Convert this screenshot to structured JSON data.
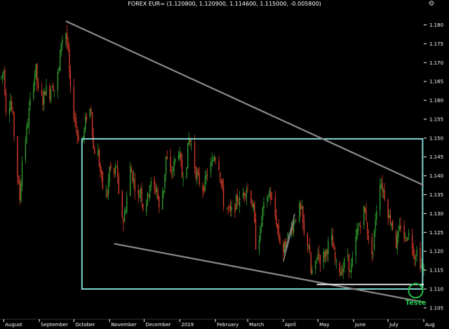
{
  "app": {
    "settings_icon": "gear-icon",
    "settings_glyph": "⚙"
  },
  "chart_data": {
    "type": "candlestick",
    "title": "FOREX EUR= (1.120800, 1.120900, 1.114600, 1.115000, -0.005800)",
    "y_ticks": [
      "1.180",
      "1.175",
      "1.170",
      "1.165",
      "1.160",
      "1.155",
      "1.150",
      "1.145",
      "1.140",
      "1.135",
      "1.130",
      "1.125",
      "1.120",
      "1.115",
      "1.110",
      "1.105"
    ],
    "ylim": [
      1.102,
      1.184
    ],
    "x_ticks": [
      "August",
      "September",
      "October",
      "November",
      "December",
      "2019",
      "February",
      "March",
      "April",
      "May",
      "June",
      "July",
      "Aug"
    ],
    "xlim": [
      "2018-07-30",
      "2019-08-01"
    ],
    "annotation_label": "Teste",
    "colors": {
      "background": "#000000",
      "up": "#2e9b2e",
      "down": "#d43a2a",
      "trendline": "#8a8a8a",
      "box": "#7fd6cf",
      "support": "#ffffff",
      "annotation": "#22c24a"
    },
    "trendlines": [
      {
        "from": [
          "2018-09-24",
          1.181
        ],
        "to": [
          "2019-08-01",
          1.1375
        ]
      },
      {
        "from": [
          "2018-11-05",
          1.122
        ],
        "to": [
          "2019-08-01",
          1.1065
        ]
      },
      {
        "from": [
          "2019-04-02",
          1.1195
        ],
        "to": [
          "2019-04-11",
          1.13
        ]
      },
      {
        "from": [
          "2019-04-01",
          1.1172
        ],
        "to": [
          "2019-04-10",
          1.1277
        ]
      }
    ],
    "rectangle": {
      "x": [
        "2018-10-08",
        "2019-07-31"
      ],
      "y": [
        1.11,
        1.1498
      ]
    },
    "support": {
      "x": [
        "2019-04-30",
        "2019-08-01"
      ],
      "y": 1.1112
    },
    "highlight": {
      "x": "2019-07-25",
      "y": 1.1088
    },
    "price_path": [
      [
        "2018-07-30",
        1.166
      ],
      [
        "2018-08-01",
        1.168
      ],
      [
        "2018-08-03",
        1.158
      ],
      [
        "2018-08-07",
        1.16
      ],
      [
        "2018-08-09",
        1.155
      ],
      [
        "2018-08-13",
        1.14
      ],
      [
        "2018-08-15",
        1.134
      ],
      [
        "2018-08-17",
        1.144
      ],
      [
        "2018-08-21",
        1.152
      ],
      [
        "2018-08-23",
        1.157
      ],
      [
        "2018-08-27",
        1.166
      ],
      [
        "2018-08-29",
        1.168
      ],
      [
        "2018-08-31",
        1.162
      ],
      [
        "2018-09-04",
        1.16
      ],
      [
        "2018-09-06",
        1.163
      ],
      [
        "2018-09-10",
        1.162
      ],
      [
        "2018-09-12",
        1.165
      ],
      [
        "2018-09-14",
        1.163
      ],
      [
        "2018-09-18",
        1.168
      ],
      [
        "2018-09-20",
        1.176
      ],
      [
        "2018-09-24",
        1.178
      ],
      [
        "2018-09-26",
        1.172
      ],
      [
        "2018-09-28",
        1.162
      ],
      [
        "2018-10-02",
        1.155
      ],
      [
        "2018-10-04",
        1.151
      ],
      [
        "2018-10-08",
        1.149
      ],
      [
        "2018-10-10",
        1.152
      ],
      [
        "2018-10-12",
        1.156
      ],
      [
        "2018-10-16",
        1.158
      ],
      [
        "2018-10-18",
        1.147
      ],
      [
        "2018-10-22",
        1.146
      ],
      [
        "2018-10-24",
        1.141
      ],
      [
        "2018-10-26",
        1.137
      ],
      [
        "2018-10-30",
        1.135
      ],
      [
        "2018-11-01",
        1.142
      ],
      [
        "2018-11-05",
        1.14
      ],
      [
        "2018-11-07",
        1.143
      ],
      [
        "2018-11-09",
        1.134
      ],
      [
        "2018-11-13",
        1.128
      ],
      [
        "2018-11-15",
        1.132
      ],
      [
        "2018-11-19",
        1.142
      ],
      [
        "2018-11-21",
        1.14
      ],
      [
        "2018-11-26",
        1.134
      ],
      [
        "2018-11-28",
        1.137
      ],
      [
        "2018-11-30",
        1.132
      ],
      [
        "2018-12-04",
        1.134
      ],
      [
        "2018-12-06",
        1.138
      ],
      [
        "2018-12-10",
        1.136
      ],
      [
        "2018-12-12",
        1.137
      ],
      [
        "2018-12-14",
        1.131
      ],
      [
        "2018-12-18",
        1.137
      ],
      [
        "2018-12-20",
        1.145
      ],
      [
        "2018-12-24",
        1.14
      ],
      [
        "2018-12-27",
        1.143
      ],
      [
        "2018-12-31",
        1.147
      ],
      [
        "2019-01-03",
        1.14
      ],
      [
        "2019-01-07",
        1.144
      ],
      [
        "2019-01-09",
        1.15
      ],
      [
        "2019-01-11",
        1.148
      ],
      [
        "2019-01-15",
        1.141
      ],
      [
        "2019-01-17",
        1.139
      ],
      [
        "2019-01-21",
        1.137
      ],
      [
        "2019-01-23",
        1.138
      ],
      [
        "2019-01-25",
        1.141
      ],
      [
        "2019-01-29",
        1.143
      ],
      [
        "2019-01-31",
        1.146
      ],
      [
        "2019-02-04",
        1.143
      ],
      [
        "2019-02-06",
        1.138
      ],
      [
        "2019-02-08",
        1.133
      ],
      [
        "2019-02-12",
        1.131
      ],
      [
        "2019-02-14",
        1.13
      ],
      [
        "2019-02-18",
        1.132
      ],
      [
        "2019-02-20",
        1.134
      ],
      [
        "2019-02-22",
        1.133
      ],
      [
        "2019-02-26",
        1.136
      ],
      [
        "2019-02-28",
        1.137
      ],
      [
        "2019-03-04",
        1.134
      ],
      [
        "2019-03-06",
        1.131
      ],
      [
        "2019-03-08",
        1.122
      ],
      [
        "2019-03-12",
        1.125
      ],
      [
        "2019-03-14",
        1.131
      ],
      [
        "2019-03-18",
        1.133
      ],
      [
        "2019-03-20",
        1.136
      ],
      [
        "2019-03-22",
        1.133
      ],
      [
        "2019-03-26",
        1.128
      ],
      [
        "2019-03-28",
        1.124
      ],
      [
        "2019-04-01",
        1.12
      ],
      [
        "2019-04-03",
        1.122
      ],
      [
        "2019-04-05",
        1.124
      ],
      [
        "2019-04-09",
        1.127
      ],
      [
        "2019-04-11",
        1.129
      ],
      [
        "2019-04-15",
        1.131
      ],
      [
        "2019-04-17",
        1.13
      ],
      [
        "2019-04-19",
        1.124
      ],
      [
        "2019-04-23",
        1.122
      ],
      [
        "2019-04-25",
        1.114
      ],
      [
        "2019-04-29",
        1.116
      ],
      [
        "2019-05-01",
        1.12
      ],
      [
        "2019-05-03",
        1.118
      ],
      [
        "2019-05-07",
        1.119
      ],
      [
        "2019-05-09",
        1.121
      ],
      [
        "2019-05-13",
        1.123
      ],
      [
        "2019-05-15",
        1.119
      ],
      [
        "2019-05-17",
        1.116
      ],
      [
        "2019-05-21",
        1.115
      ],
      [
        "2019-05-23",
        1.116
      ],
      [
        "2019-05-27",
        1.119
      ],
      [
        "2019-05-29",
        1.114
      ],
      [
        "2019-05-31",
        1.117
      ],
      [
        "2019-06-04",
        1.125
      ],
      [
        "2019-06-06",
        1.127
      ],
      [
        "2019-06-10",
        1.131
      ],
      [
        "2019-06-12",
        1.129
      ],
      [
        "2019-06-14",
        1.122
      ],
      [
        "2019-06-18",
        1.12
      ],
      [
        "2019-06-20",
        1.129
      ],
      [
        "2019-06-24",
        1.139
      ],
      [
        "2019-06-26",
        1.137
      ],
      [
        "2019-06-28",
        1.135
      ],
      [
        "2019-07-02",
        1.129
      ],
      [
        "2019-07-04",
        1.128
      ],
      [
        "2019-07-08",
        1.122
      ],
      [
        "2019-07-10",
        1.124
      ],
      [
        "2019-07-12",
        1.127
      ],
      [
        "2019-07-16",
        1.123
      ],
      [
        "2019-07-18",
        1.125
      ],
      [
        "2019-07-22",
        1.122
      ],
      [
        "2019-07-24",
        1.119
      ],
      [
        "2019-07-26",
        1.12
      ],
      [
        "2019-07-29",
        1.117
      ],
      [
        "2019-07-31",
        1.115
      ]
    ]
  }
}
